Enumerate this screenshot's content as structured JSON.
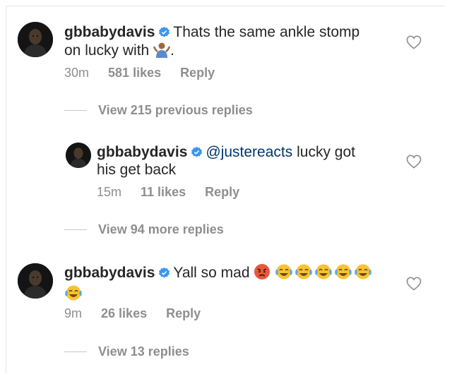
{
  "comments": [
    {
      "username": "gbbabydavis",
      "text": "Thats the same ankle stomp on lucky with",
      "text_line1": "Thats the same ankle stomp",
      "text_line2_prefix": "on lucky with",
      "text_suffix": ".",
      "emoji": "person-shrugging-emoji",
      "time": "30m",
      "likes": "581 likes",
      "reply": "Reply",
      "view_replies": "View 215 previous replies"
    },
    {
      "username": "gbbabydavis",
      "mention": "@justereacts",
      "text_line1": "lucky got",
      "text_line2": "his get back",
      "time": "15m",
      "likes": "11 likes",
      "reply": "Reply",
      "view_replies": "View 94 more replies"
    },
    {
      "username": "gbbabydavis",
      "text": "Yall so mad",
      "emojis": [
        "pouting-face-emoji",
        "face-with-tears-of-joy-emoji"
      ],
      "time": "9m",
      "likes": "26 likes",
      "reply": "Reply",
      "view_replies": "View 13 replies"
    }
  ],
  "icons": {
    "verified": "verified-badge-icon",
    "like": "heart-outline-icon"
  },
  "colors": {
    "verified_blue": "#3897f0",
    "mention": "#00376b",
    "muted": "#8e8e8e",
    "text": "#262626"
  }
}
